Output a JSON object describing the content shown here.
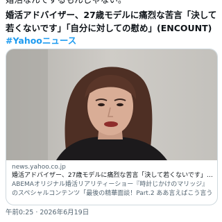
{
  "post": {
    "text_cut": "婚活なんてするもんじゃない。",
    "text": "婚活アドバイザー、27歳モデルに痛烈な苦言「決して若くないです」「自分に対しての慰め」(ENCOUNT)",
    "hashtag": "#Yahooニュース",
    "timestamp": "午前0:25 · 2026年6月19日"
  },
  "card": {
    "domain": "news.yahoo.co.jp",
    "title": "婚活アドバイザー、27歳モデルに痛烈な苦言「決して若くないです」「...",
    "description_line1": "ABEMAオリジナル婚活リアリティーショー『時計じかけのマリッジ』",
    "description_line2": "のスペシャルコンテンツ「最後の精華面談！Part.2 ああ言えばこう言う..."
  },
  "colors": {
    "link": "#1d9bf0",
    "text": "#0f1419",
    "secondary": "#536471",
    "border": "#cfd9de"
  }
}
